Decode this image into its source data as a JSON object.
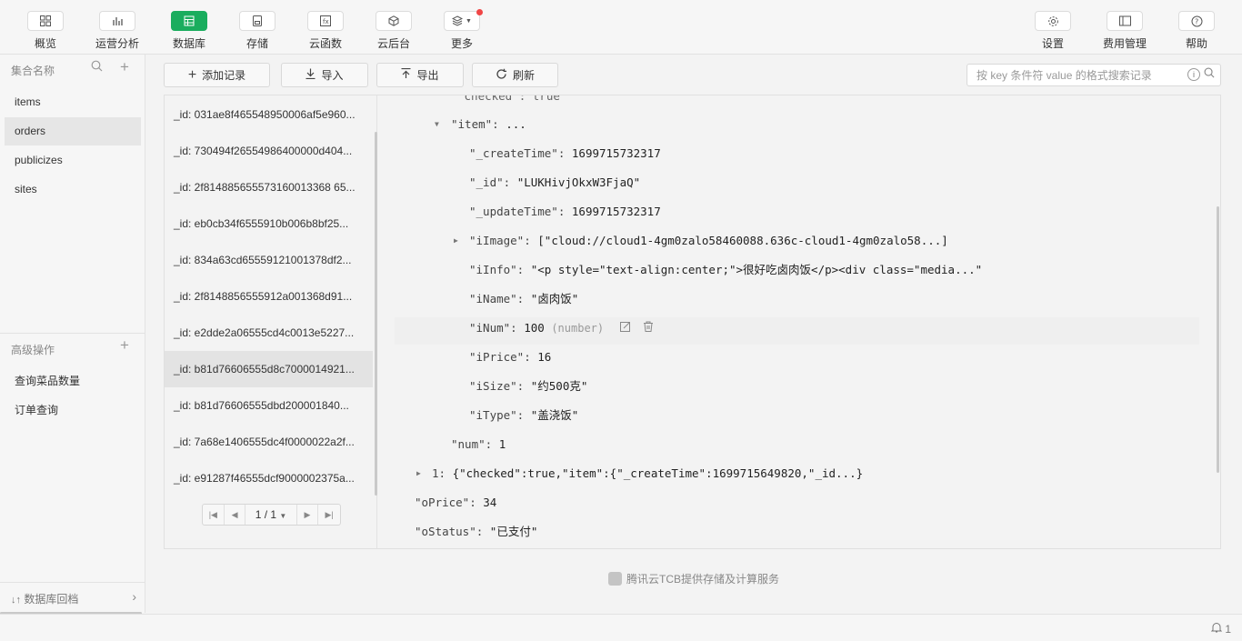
{
  "toolbar": {
    "items": [
      {
        "label": "概览",
        "icon": "grid-icon"
      },
      {
        "label": "运营分析",
        "icon": "bar-chart-icon"
      },
      {
        "label": "数据库",
        "icon": "database-icon"
      },
      {
        "label": "存储",
        "icon": "storage-icon"
      },
      {
        "label": "云函数",
        "icon": "function-icon"
      },
      {
        "label": "云后台",
        "icon": "cube-icon"
      },
      {
        "label": "更多",
        "icon": "layers-icon"
      }
    ],
    "right": [
      {
        "label": "设置",
        "icon": "gear-icon"
      },
      {
        "label": "费用管理",
        "icon": "billing-icon"
      },
      {
        "label": "帮助",
        "icon": "help-icon"
      }
    ],
    "accent": "#1aad5e"
  },
  "sidebar": {
    "collections_title": "集合名称",
    "collections": [
      "items",
      "orders",
      "publicizes",
      "sites"
    ],
    "active_collection": "orders",
    "advanced_title": "高级操作",
    "advanced": [
      "查询菜品数量",
      "订单查询"
    ],
    "footer": "数据库回档"
  },
  "actions": {
    "add": "添加记录",
    "import": "导入",
    "export": "导出",
    "refresh": "刷新"
  },
  "search": {
    "placeholder": "按 key 条件符 value 的格式搜索记录"
  },
  "records": [
    "_id: 031ae8f465548950006af5e960...",
    "_id: 730494f26554986400000d404...",
    "_id: 2f814885655573160013368 65...",
    "_id: eb0cb34f6555910b006b8bf25...",
    "_id: 834a63cd65559121001378df2...",
    "_id: 2f8148856555912a001368d91...",
    "_id: e2dde2a06555cd4c0013e5227...",
    "_id: b81d76606555d8c7000014921...",
    "_id: b81d76606555dbd200001840...",
    "_id: 7a68e1406555dc4f0000022a2f...",
    "_id: e91287f46555dcf9000002375a..."
  ],
  "pager": {
    "label": "1 / 1"
  },
  "detail": {
    "checked_cut": "\"checked\": true",
    "item_key": "\"item\":",
    "item_val": "...",
    "fields": [
      {
        "key": "\"_createTime\":",
        "val": "1699715732317"
      },
      {
        "key": "\"_id\":",
        "val": "\"LUKHivjOkxW3FjaQ\""
      },
      {
        "key": "\"_updateTime\":",
        "val": "1699715732317"
      },
      {
        "key": "\"iImage\":",
        "val": "[\"cloud://cloud1-4gm0zalo58460088.636c-cloud1-4gm0zalo58...]"
      },
      {
        "key": "\"iInfo\":",
        "val": "\"<p style=\"text-align:center;\">很好吃卤肉饭</p><div class=\"media...\""
      },
      {
        "key": "\"iName\":",
        "val": "\"卤肉饭\""
      },
      {
        "key": "\"iNum\":",
        "val": "100",
        "type": "(number)"
      },
      {
        "key": "\"iPrice\":",
        "val": "16"
      },
      {
        "key": "\"iSize\":",
        "val": "\"约500克\""
      },
      {
        "key": "\"iType\":",
        "val": "\"盖浇饭\""
      }
    ],
    "num_key": "\"num\":",
    "num_val": "1",
    "row1_key": "1:",
    "row1_val": "{\"checked\":true,\"item\":{\"_createTime\":1699715649820,\"_id...}",
    "oprice_key": "\"oPrice\":",
    "oprice_val": "34",
    "ostatus_key": "\"oStatus\":",
    "ostatus_val": "\"已支付\""
  },
  "footer_note": "腾讯云TCB提供存储及计算服务",
  "notifications": "1"
}
